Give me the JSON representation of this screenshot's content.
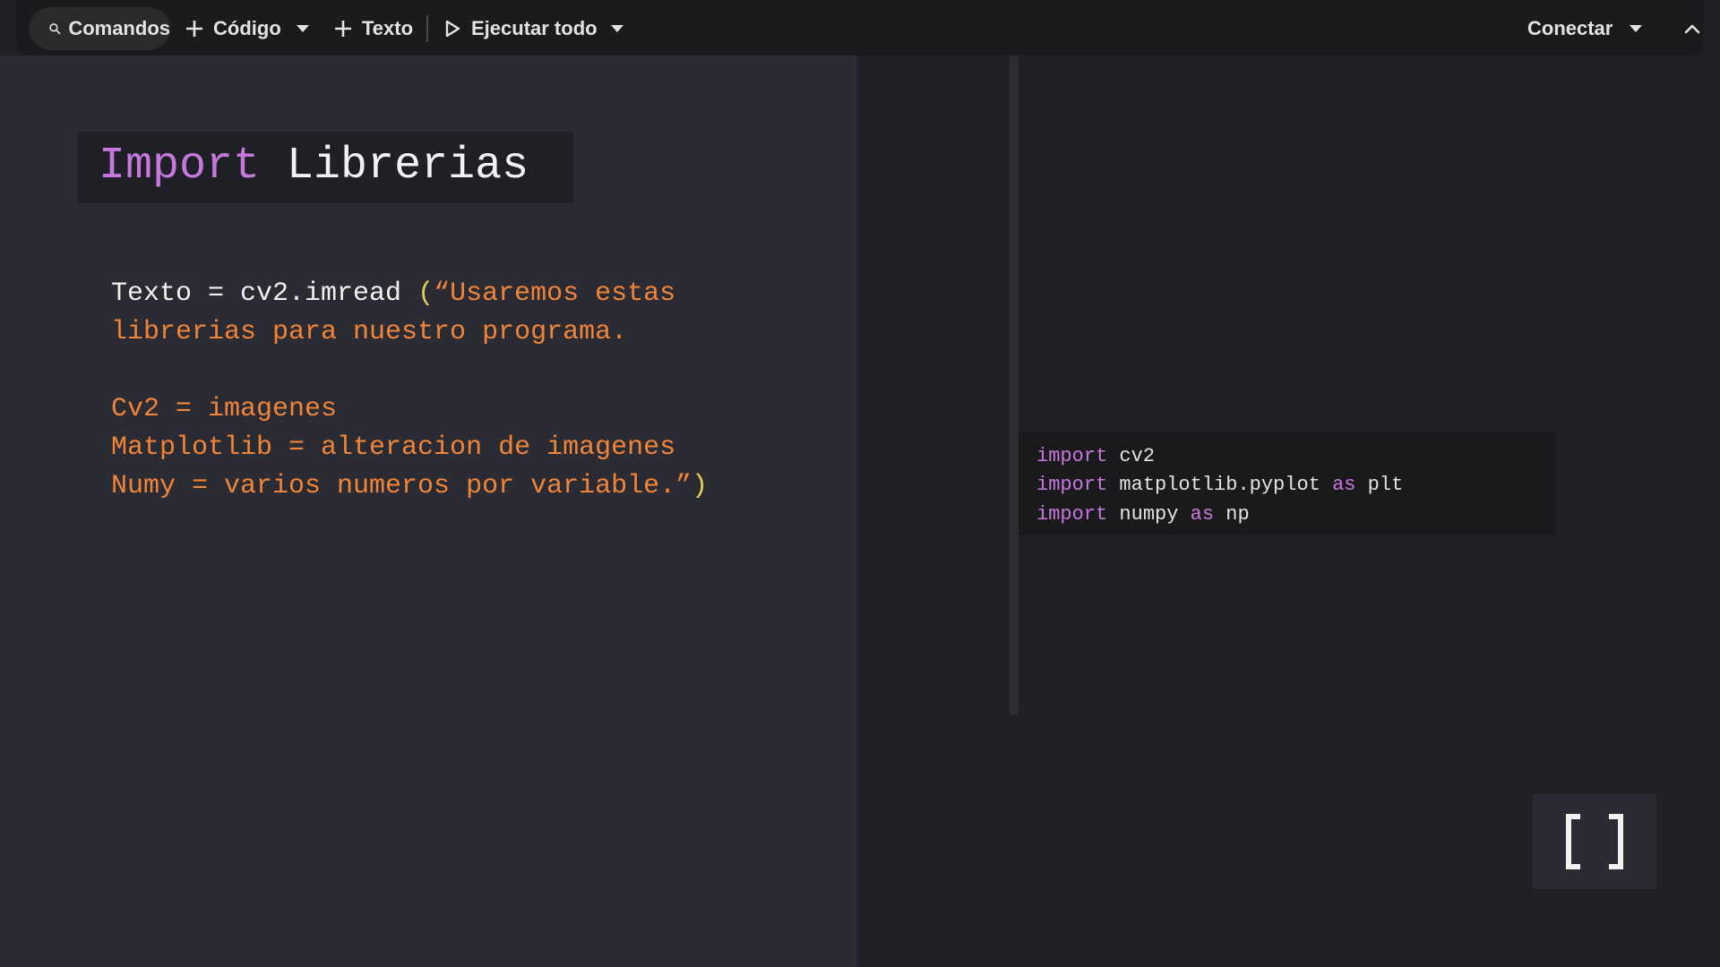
{
  "toolbar": {
    "commands_label": "Comandos",
    "code_label": "Código",
    "text_label": "Texto",
    "run_all_label": "Ejecutar todo",
    "connect_label": "Conectar"
  },
  "text_cell": {
    "title_keyword": "Import",
    "title_rest": "Librerias",
    "line1_white": "Texto = cv2.imread ",
    "line1_paren": "(",
    "line1_orange": "“Usaremos estas",
    "line2": "librerias para nuestro programa.",
    "line3": "Cv2 = imagenes",
    "line4": "Matplotlib = alteracion de imagenes",
    "line5_orange": "Numy = varios numeros por variable.”",
    "line5_paren": ")"
  },
  "code_cell": {
    "lines": [
      {
        "kw": "import",
        "rest": " cv2",
        "kw2": "",
        "rest2": ""
      },
      {
        "kw": "import",
        "rest": " matplotlib.pyplot ",
        "kw2": "as",
        "rest2": " plt"
      },
      {
        "kw": "import",
        "rest": " numpy ",
        "kw2": "as",
        "rest2": " np"
      }
    ]
  },
  "colors": {
    "keyword": "#c678dd",
    "string": "#f0853a",
    "paren": "#e5d15a",
    "background": "#202124"
  },
  "icons": [
    "search-icon",
    "plus-icon",
    "chevron-down-icon",
    "play-icon",
    "chevron-up-icon",
    "brackets-icon"
  ]
}
